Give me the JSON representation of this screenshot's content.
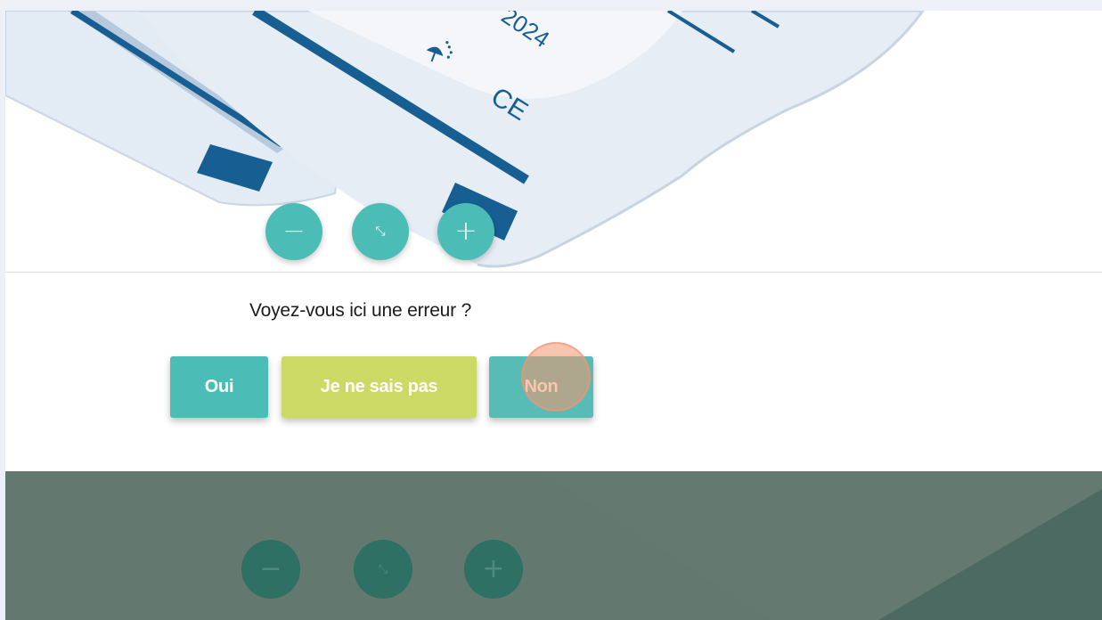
{
  "image_viewer": {
    "label_text": "2024",
    "ce_mark": "CE",
    "zoom_out_icon": "minus-icon",
    "zoom_reset_icon": "reset-zoom-icon",
    "zoom_in_icon": "plus-icon",
    "zoom_out_glyph": "−",
    "zoom_reset_glyph": "⤡",
    "zoom_in_glyph": "+"
  },
  "question": {
    "text": "Voyez-vous ici une erreur ?",
    "answers": {
      "yes": "Oui",
      "dont_know": "Je ne sais pas",
      "no": "Non"
    }
  },
  "overlay": {
    "zoom_out_glyph": "−",
    "zoom_reset_glyph": "⤡",
    "zoom_in_glyph": "+"
  },
  "colors": {
    "teal": "#4bbdb6",
    "lime": "#cbd965",
    "overlay": "#63786f",
    "label_blue": "#135e93"
  }
}
